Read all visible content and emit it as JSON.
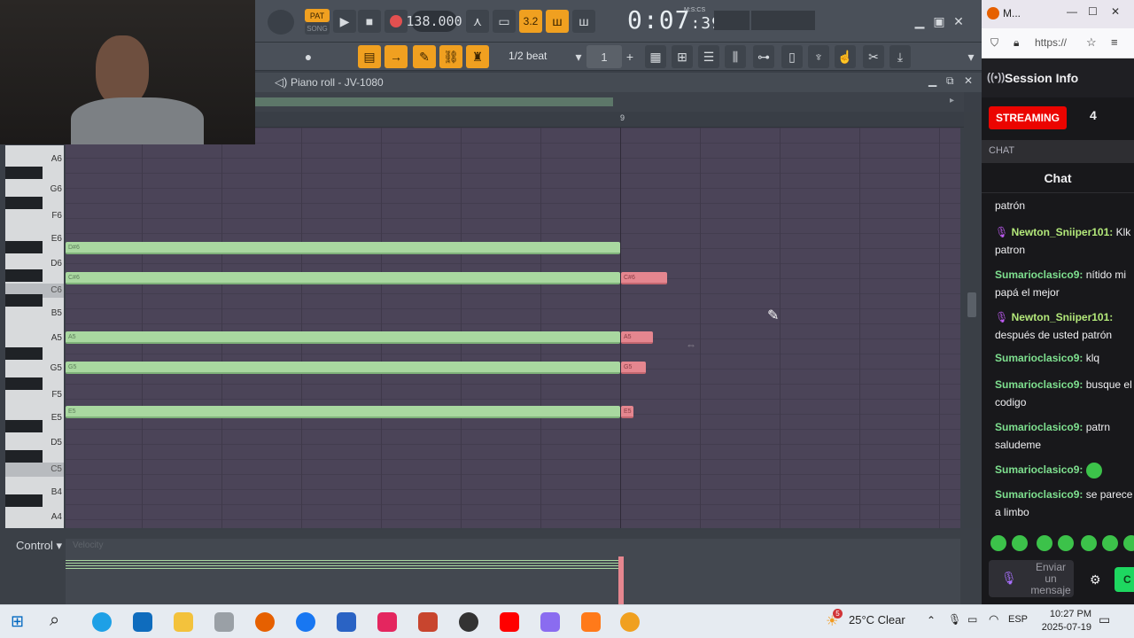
{
  "fl": {
    "pat_label": "PAT",
    "song_label": "SONG",
    "tempo": "138.000",
    "time_main": "0:07",
    "time_small": ":39",
    "time_mode": "M:S:CS",
    "step_label": "3.2",
    "snap": "1/2 beat",
    "stamp_value": "1",
    "piano_roll_title": "Piano roll - JV-1080",
    "ruler_bar": "9",
    "control_label": "Control",
    "control_sub": "Velocity"
  },
  "keys": {
    "labels": [
      {
        "name": "A6"
      },
      {
        "name": "G6"
      },
      {
        "name": "F6"
      },
      {
        "name": "E6"
      },
      {
        "name": "D6"
      },
      {
        "name": "C6"
      },
      {
        "name": "B5"
      },
      {
        "name": "A5"
      },
      {
        "name": "G5"
      },
      {
        "name": "F5"
      },
      {
        "name": "E5"
      },
      {
        "name": "D5"
      },
      {
        "name": "C5"
      },
      {
        "name": "B4"
      },
      {
        "name": "A4"
      }
    ]
  },
  "notes": [
    {
      "label": "D#6",
      "color": "#a9d8a0"
    },
    {
      "label": "C#6",
      "color": "#a9d8a0"
    },
    {
      "label": "C#6",
      "color": "#e5868f"
    },
    {
      "label": "A5",
      "color": "#a9d8a0"
    },
    {
      "label": "A5",
      "color": "#e5868f"
    },
    {
      "label": "G5",
      "color": "#a9d8a0"
    },
    {
      "label": "G5",
      "color": "#e5868f"
    },
    {
      "label": "E5",
      "color": "#a9d8a0"
    },
    {
      "label": "E5",
      "color": "#e5868f"
    }
  ],
  "browser": {
    "tab_title": "M...",
    "address": "https://"
  },
  "stream": {
    "session_title": "Session Info",
    "status": "STREAMING",
    "count": "4",
    "chat_tab": "CHAT",
    "chat_header": "Chat"
  },
  "chat": {
    "messages": [
      {
        "user": "",
        "text": "patrón"
      },
      {
        "user": "Newton_Sniiper101:",
        "text": "Klk patron"
      },
      {
        "user": "Sumarioclasico9:",
        "text": "nítido mi papá el mejor"
      },
      {
        "user": "Newton_Sniiper101:",
        "text": "después de usted patrón"
      },
      {
        "user": "Sumarioclasico9:",
        "text": "klq"
      },
      {
        "user": "Sumarioclasico9:",
        "text": "busque el codigo"
      },
      {
        "user": "Sumarioclasico9:",
        "text": "patrn saludeme"
      },
      {
        "user": "Sumarioclasico9:",
        "text": ""
      },
      {
        "user": "Sumarioclasico9:",
        "text": "se parece a limbo"
      }
    ],
    "input_placeholder": "Enviar un mensaje",
    "send_label": "C"
  },
  "taskbar": {
    "weather": "25°C  Clear",
    "lang": "ESP",
    "time": "10:27 PM",
    "date": "2025-07-19",
    "weather_badge": "5"
  },
  "colors": {
    "accent_orange": "#f0a020",
    "note_green": "#a9d8a0",
    "note_red": "#e5868f",
    "streaming_red": "#eb0400",
    "chat_green": "#7ee08f"
  }
}
